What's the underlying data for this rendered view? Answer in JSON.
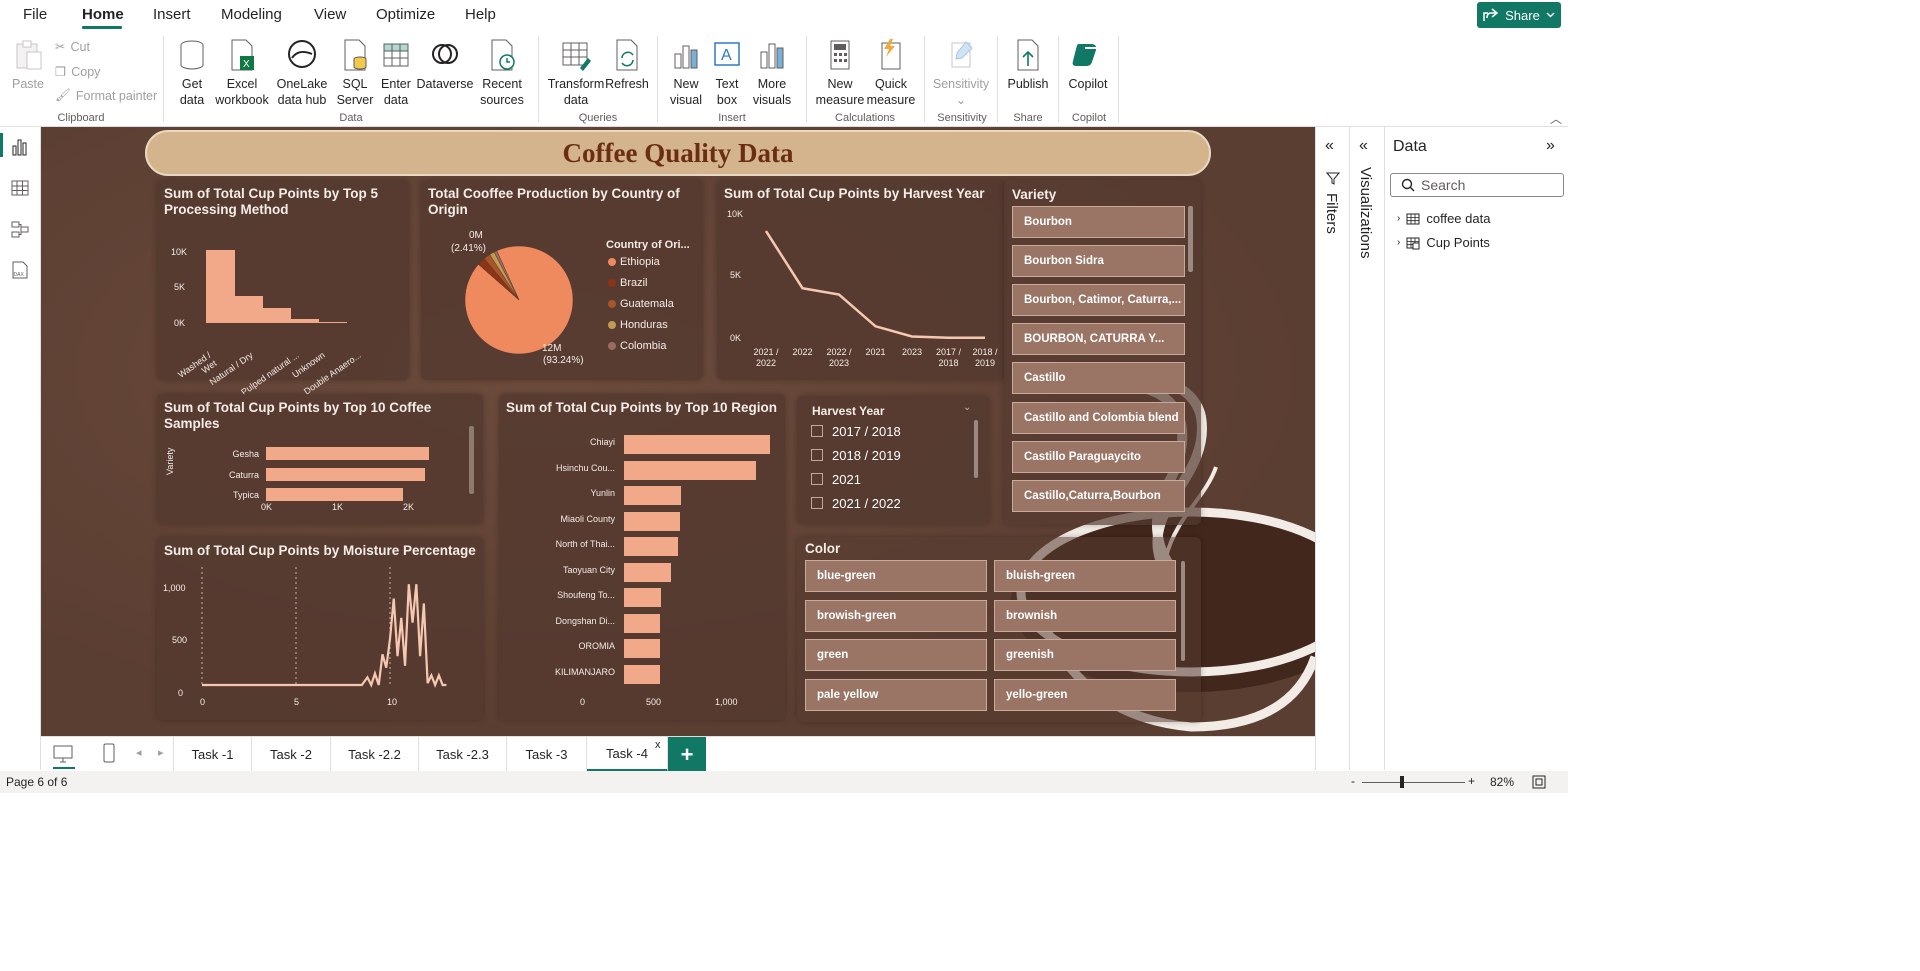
{
  "menubar": {
    "items": [
      "File",
      "Home",
      "Insert",
      "Modeling",
      "View",
      "Optimize",
      "Help"
    ],
    "share": "Share"
  },
  "ribbon": {
    "clipboard": {
      "paste": "Paste",
      "cut": "Cut",
      "copy": "Copy",
      "format_painter": "Format painter",
      "label": "Clipboard"
    },
    "data": {
      "get_data": [
        "Get",
        "data"
      ],
      "excel": [
        "Excel",
        "workbook"
      ],
      "onelake": [
        "OneLake",
        "data hub"
      ],
      "sql": [
        "SQL",
        "Server"
      ],
      "enter": [
        "Enter",
        "data"
      ],
      "dataverse": "Dataverse",
      "recent": [
        "Recent",
        "sources"
      ],
      "label": "Data"
    },
    "queries": {
      "transform": [
        "Transform",
        "data"
      ],
      "refresh": "Refresh",
      "label": "Queries"
    },
    "insert": {
      "new_visual": [
        "New",
        "visual"
      ],
      "text_box": [
        "Text",
        "box"
      ],
      "more_visuals": [
        "More",
        "visuals"
      ],
      "label": "Insert"
    },
    "calculations": {
      "new_measure": [
        "New",
        "measure"
      ],
      "quick_measure": [
        "Quick",
        "measure"
      ],
      "label": "Calculations"
    },
    "sensitivity": {
      "btn": "Sensitivity",
      "label": "Sensitivity"
    },
    "share": {
      "publish": "Publish",
      "label": "Share"
    },
    "copilot": {
      "btn": "Copilot",
      "label": "Copilot"
    }
  },
  "report": {
    "title": "Coffee Quality Data",
    "processing": {
      "title": "Sum of Total Cup Points by Top 5 Processing Method",
      "yticks": [
        "10K",
        "5K",
        "0K"
      ],
      "categories": [
        "Washed / Wet",
        "Natural / Dry",
        "Pulped natural ...",
        "Unknown",
        "Double Anaero..."
      ]
    },
    "production": {
      "title": "Total Cooffee Production by Country of Origin",
      "label_small": [
        "0M",
        "(2.41%)"
      ],
      "label_big": [
        "12M",
        "(93.24%)"
      ],
      "legend_title": "Country of Ori...",
      "legend": [
        "Ethiopia",
        "Brazil",
        "Guatemala",
        "Honduras",
        "Colombia"
      ]
    },
    "harvest": {
      "title": "Sum of Total Cup Points by Harvest Year",
      "yticks": [
        "10K",
        "5K",
        "0K"
      ],
      "xticks": [
        [
          "2021 /",
          "2022"
        ],
        [
          "2022",
          ""
        ],
        [
          "2022 /",
          "2023"
        ],
        [
          "2021",
          ""
        ],
        [
          "2023",
          ""
        ],
        [
          "2017 /",
          "2018"
        ],
        [
          "2018 /",
          "2019"
        ]
      ]
    },
    "variety_slicer": {
      "title": "Variety",
      "items": [
        "Bourbon",
        "Bourbon Sidra",
        "Bourbon, Catimor, Caturra,...",
        "BOURBON, CATURRA Y...",
        "Castillo",
        "Castillo and Colombia blend",
        "Castillo Paraguaycito",
        "Castillo,Caturra,Bourbon"
      ]
    },
    "samples": {
      "title": "Sum of Total Cup Points by Top 10 Coffee Samples",
      "axis_label": "Variety",
      "categories": [
        "Gesha",
        "Caturra",
        "Typica"
      ],
      "xticks": [
        "0K",
        "1K",
        "2K"
      ]
    },
    "region": {
      "title": "Sum of Total Cup Points by Top 10 Region",
      "categories": [
        "Chiayi",
        "Hsinchu Cou...",
        "Yunlin",
        "Miaoli County",
        "North of Thai...",
        "Taoyuan City",
        "Shoufeng To...",
        "Dongshan Di...",
        "OROMIA",
        "KILIMANJARO"
      ],
      "xticks": [
        "0",
        "500",
        "1,000"
      ]
    },
    "harvest_slicer": {
      "title": "Harvest Year",
      "items": [
        "2017 / 2018",
        "2018 / 2019",
        "2021",
        "2021 / 2022"
      ]
    },
    "moisture": {
      "title": "Sum of Total Cup Points by Moisture Percentage",
      "yticks": [
        "1,000",
        "500",
        "0"
      ],
      "xticks": [
        "0",
        "5",
        "10"
      ]
    },
    "color_slicer": {
      "title": "Color",
      "items": [
        "blue-green",
        "bluish-green",
        "browish-green",
        "brownish",
        "green",
        "greenish",
        "pale yellow",
        "yello-green"
      ]
    }
  },
  "chart_data": [
    {
      "type": "bar",
      "title": "Sum of Total Cup Points by Top 5 Processing Method",
      "categories": [
        "Washed / Wet",
        "Natural / Dry",
        "Pulped natural ...",
        "Unknown",
        "Double Anaero..."
      ],
      "values": [
        10100,
        3700,
        2050,
        560,
        170
      ],
      "ylim": [
        0,
        10000
      ]
    },
    {
      "type": "pie",
      "title": "Total Cooffee Production by Country of Origin",
      "categories": [
        "Ethiopia",
        "Brazil",
        "Guatemala",
        "Honduras",
        "Colombia"
      ],
      "values": [
        93.24,
        2.41,
        2.0,
        1.5,
        0.85
      ],
      "colors": [
        "#ef8a5e",
        "#8b3516",
        "#a9552a",
        "#c49a52",
        "#9b6b62"
      ]
    },
    {
      "type": "line",
      "title": "Sum of Total Cup Points by Harvest Year",
      "categories": [
        "2021 / 2022",
        "2022",
        "2022 / 2023",
        "2021",
        "2023",
        "2017 / 2018",
        "2018 / 2019"
      ],
      "values": [
        8500,
        4000,
        3500,
        1000,
        200,
        100,
        100
      ],
      "ylim": [
        0,
        10000
      ]
    },
    {
      "type": "bar",
      "title": "Sum of Total Cup Points by Top 10 Coffee Samples",
      "categories": [
        "Gesha",
        "Caturra",
        "Typica"
      ],
      "values": [
        2300,
        2240,
        1930
      ],
      "xlim": [
        0,
        2000
      ]
    },
    {
      "type": "bar",
      "title": "Sum of Total Cup Points by Top 10 Region",
      "categories": [
        "Chiayi",
        "Hsinchu Cou...",
        "Yunlin",
        "Miaoli County",
        "North of Thai...",
        "Taoyuan City",
        "Shoufeng To...",
        "Dongshan Di...",
        "OROMIA",
        "KILIMANJARO"
      ],
      "values": [
        1020,
        920,
        400,
        390,
        380,
        330,
        260,
        255,
        250,
        250
      ],
      "xlim": [
        0,
        1000
      ]
    },
    {
      "type": "line",
      "title": "Sum of Total Cup Points by Moisture Percentage",
      "x": [
        0,
        8.5,
        8.8,
        9.0,
        9.2,
        9.4,
        9.6,
        9.8,
        10.0,
        10.2,
        10.4,
        10.6,
        10.8,
        11.0,
        11.2,
        11.4,
        11.6,
        11.8,
        12.0,
        12.2,
        12.4,
        12.6,
        12.8,
        13.0
      ],
      "y": [
        0,
        0,
        80,
        0,
        120,
        0,
        320,
        180,
        480,
        900,
        300,
        700,
        200,
        1050,
        650,
        1050,
        300,
        850,
        20,
        100,
        0,
        100,
        0,
        0
      ],
      "ylim": [
        0,
        1000
      ]
    }
  ],
  "pages": {
    "tabs": [
      "Task -1",
      "Task -2",
      "Task -2.2",
      "Task -2.3",
      "Task -3",
      "Task -4"
    ],
    "active": "Task -4",
    "close": "x",
    "add": "+"
  },
  "status": {
    "page": "Page 6 of 6",
    "zoom_minus": "-",
    "zoom_plus": "+",
    "zoom": "82%"
  },
  "panes": {
    "filters": "Filters",
    "visualizations": "Visualizations",
    "data_title": "Data",
    "search_placeholder": "Search",
    "tables": [
      "coffee data",
      "Cup Points"
    ]
  }
}
